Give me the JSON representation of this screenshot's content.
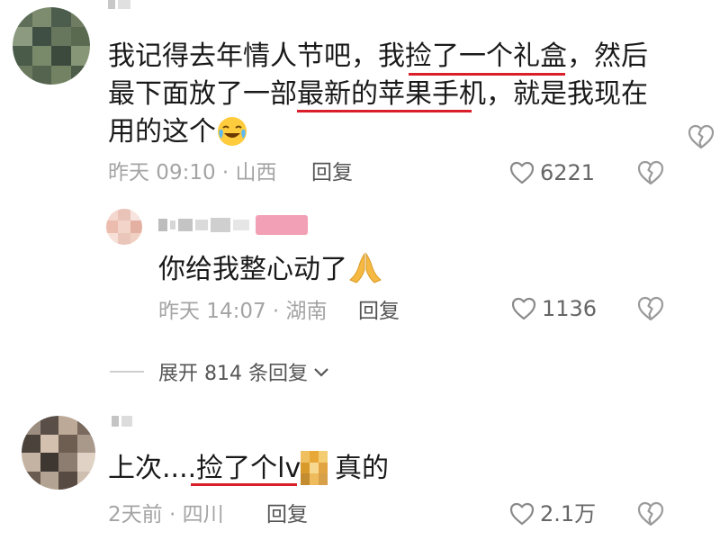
{
  "comments": [
    {
      "avatar": "pixelated-avatar",
      "lines": [
        {
          "a": "我记得去年情人节吧，我",
          "b": "捡了一个礼盒",
          "c": "，然后"
        },
        {
          "a": "最下面放了一部",
          "b": "最新的苹果手机",
          "c": "，就是我现在"
        },
        {
          "a": "用的这个",
          "emoji": "laugh-cry-emoji"
        }
      ],
      "time_location": "昨天 09:10 · 山西",
      "reply_label": "回复",
      "likes": "6221",
      "like_icon": "heart-icon",
      "dislike_icon": "broken-heart-icon"
    }
  ],
  "reply": {
    "avatar": "pixelated-avatar",
    "text": "你给我整心动了",
    "emoji": "pray-emoji",
    "time_location": "昨天 14:07 · 湖南",
    "reply_label": "回复",
    "likes": "1136"
  },
  "expand": {
    "label": "展开 814 条回复",
    "icon": "chevron-down-icon"
  },
  "comment2": {
    "avatar": "pixelated-avatar",
    "text_a": "上次....",
    "text_b": "捡了个lv",
    "text_c": "真的",
    "thumb": "pixelated-image",
    "time_location": "2天前 · 四川",
    "reply_label": "回复",
    "likes": "2.1万"
  },
  "colors": {
    "underline": "#d9202a",
    "meta": "#a4a4a4",
    "text": "#1a1a1a",
    "badge": "#f2a0b5"
  }
}
